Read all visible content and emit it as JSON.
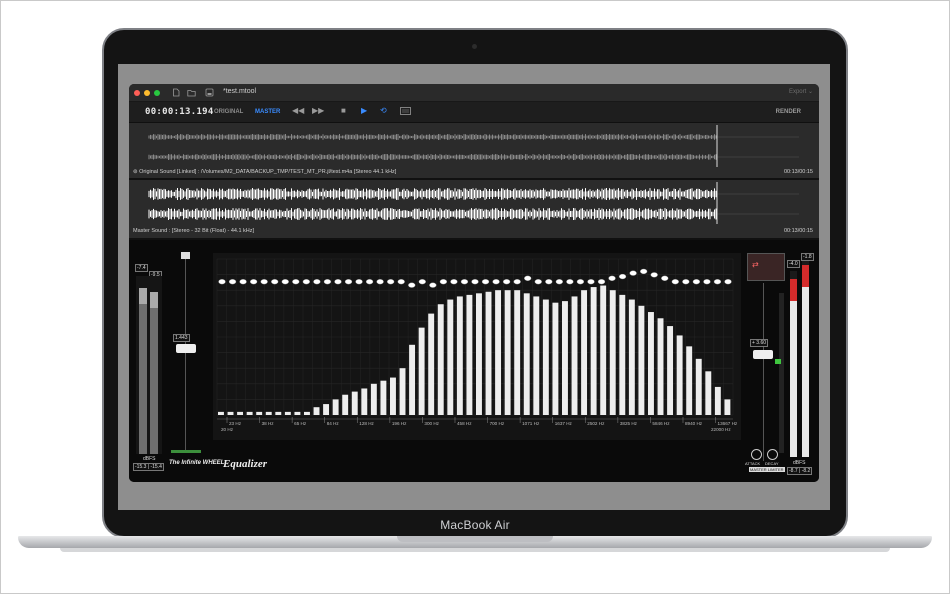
{
  "device": {
    "brand_label": "MacBook Air"
  },
  "window": {
    "title": "*test.mtool",
    "export_label": "Export",
    "traffic_lights": {
      "close": "#ff5f57",
      "minimize": "#febc2e",
      "zoom": "#28c840"
    },
    "titlebar_icons": [
      "document-icon",
      "folder-icon",
      "save-icon"
    ]
  },
  "toolbar": {
    "timecode": "00:00:13.194",
    "original_label": "ORIGINAL",
    "master_label": "MASTER",
    "render_label": "RENDER",
    "controls": [
      "rewind-icon",
      "fast-forward-icon",
      "stop-icon",
      "play-icon",
      "loop-icon",
      "marker-icon"
    ],
    "accent_color": "#3a8cff"
  },
  "tracks": [
    {
      "info": "Original Sound [Linked] : /Volumes/M2_DATA/BACKUP_TMP/TEST_MT_PR.jl/test.m4a [Stereo 44.1 kHz]",
      "time": "00:13/00:15"
    },
    {
      "info": "Master Sound : [Stereo - 32 Bit (Float) - 44.1 kHz]",
      "time": "00:13/00:15"
    }
  ],
  "left_meter": {
    "peak_l": "-7.4",
    "peak_r": "-9.5",
    "unit": "dBFS",
    "readout": "-15.3 | -15.4"
  },
  "gain_fader": {
    "value": "1.443"
  },
  "eq": {
    "frequency_labels": [
      "23 Hz",
      "38 Hz",
      "65 Hz",
      "84 Hz",
      "128 Hz",
      "196 Hz",
      "300 Hz",
      "458 Hz",
      "700 Hz",
      "1071 Hz",
      "1637 Hz",
      "2502 Hz",
      "3825 Hz",
      "5846 Hz",
      "8940 Hz",
      "13667 Hz"
    ],
    "range_start": "20 Hz",
    "range_end": "22000 Hz",
    "band_levels": [
      0.02,
      0.02,
      0.02,
      0.02,
      0.02,
      0.02,
      0.02,
      0.02,
      0.02,
      0.02,
      0.05,
      0.07,
      0.1,
      0.13,
      0.15,
      0.17,
      0.2,
      0.22,
      0.24,
      0.3,
      0.45,
      0.56,
      0.65,
      0.71,
      0.74,
      0.76,
      0.77,
      0.78,
      0.79,
      0.8,
      0.8,
      0.8,
      0.78,
      0.76,
      0.74,
      0.72,
      0.73,
      0.76,
      0.8,
      0.82,
      0.83,
      0.8,
      0.77,
      0.74,
      0.7,
      0.66,
      0.62,
      0.57,
      0.51,
      0.44,
      0.36,
      0.28,
      0.18,
      0.1
    ],
    "node_levels": [
      0.8,
      0.8,
      0.8,
      0.8,
      0.8,
      0.8,
      0.8,
      0.8,
      0.8,
      0.8,
      0.8,
      0.8,
      0.8,
      0.8,
      0.8,
      0.8,
      0.8,
      0.8,
      0.78,
      0.8,
      0.78,
      0.8,
      0.8,
      0.8,
      0.8,
      0.8,
      0.8,
      0.8,
      0.8,
      0.82,
      0.8,
      0.8,
      0.8,
      0.8,
      0.8,
      0.8,
      0.8,
      0.82,
      0.83,
      0.85,
      0.86,
      0.84,
      0.82,
      0.8,
      0.8,
      0.8,
      0.8,
      0.8,
      0.8
    ]
  },
  "branding": {
    "infinite_wheel": "The Infinite WHEEL",
    "equalizer": "Equalizer"
  },
  "limiter": {
    "threshold": "+ 3.60",
    "attack_label": "ATTACK",
    "decay_label": "DECAY",
    "mode_label": "MASTER LIMITER"
  },
  "right_meter": {
    "peak_l": "-4.0",
    "peak_r": "-1.8",
    "unit": "dBFS",
    "readout": "-8.7 | -8.2",
    "peak_color": "#d42b2b"
  }
}
